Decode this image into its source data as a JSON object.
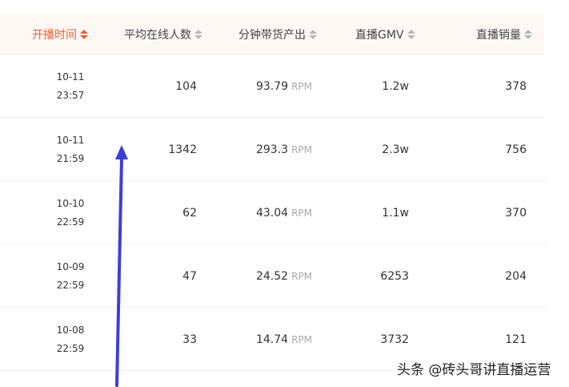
{
  "table": {
    "columns": [
      {
        "label": "开播时间",
        "active": true
      },
      {
        "label": "平均在线人数",
        "active": false
      },
      {
        "label": "分钟带货产出",
        "active": false
      },
      {
        "label": "直播GMV",
        "active": false
      },
      {
        "label": "直播销量",
        "active": false
      }
    ],
    "rpm_unit": "RPM",
    "rows": [
      {
        "date": "10-11",
        "time": "23:57",
        "avg_online": "104",
        "per_minute": "93.79",
        "gmv": "1.2w",
        "sales": "378"
      },
      {
        "date": "10-11",
        "time": "21:59",
        "avg_online": "1342",
        "per_minute": "293.3",
        "gmv": "2.3w",
        "sales": "756"
      },
      {
        "date": "10-10",
        "time": "22:59",
        "avg_online": "62",
        "per_minute": "43.04",
        "gmv": "1.1w",
        "sales": "370"
      },
      {
        "date": "10-09",
        "time": "22:59",
        "avg_online": "47",
        "per_minute": "24.52",
        "gmv": "6253",
        "sales": "204"
      },
      {
        "date": "10-08",
        "time": "22:59",
        "avg_online": "33",
        "per_minute": "14.74",
        "gmv": "3732",
        "sales": "121"
      }
    ]
  },
  "colors": {
    "accent": "#e8623a",
    "arrow": "#3b3fd8"
  },
  "watermark": "头条 @砖头哥讲直播运营"
}
